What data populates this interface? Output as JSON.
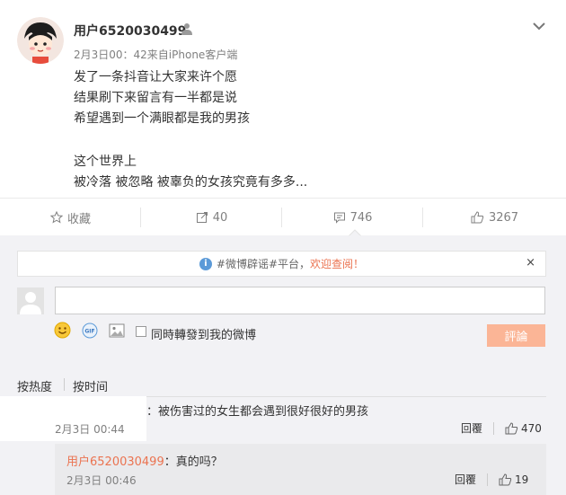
{
  "post": {
    "username": "用户6520030499",
    "meta": "2月3日00：42来自iPhone客户端",
    "lines": [
      "发了一条抖音让大家来许个愿",
      "结果刷下来留言有一半都是说",
      "希望遇到一个满眼都是我的男孩",
      "这个世界上",
      "被冷落 被忽略 被辜负的女孩究竟有多多..."
    ]
  },
  "actions": {
    "favorite": "收藏",
    "repost": "40",
    "comment": "746",
    "like": "3267"
  },
  "notice": {
    "prefix": "#微博辟谣#平台，",
    "highlight": "欢迎查阅！",
    "close": "×"
  },
  "composer": {
    "repost_label": "同時轉發到我的微博",
    "submit": "評論"
  },
  "sort": {
    "hot": "按热度",
    "time": "按时间"
  },
  "comments": [
    {
      "text": "：被伤害过的女生都会遇到很好很好的男孩",
      "time": "2月3日 00:44",
      "reply": "回覆",
      "likes": "470"
    }
  ],
  "replies": [
    {
      "name": "用户6520030499",
      "text": "：真的吗？",
      "time": "2月3日 00:46",
      "reply": "回覆",
      "likes": "19"
    }
  ],
  "colors": {
    "accent": "#eb7350",
    "submit_bg": "#fbb596",
    "comment_bg": "#f2f2f5",
    "muted": "#808080"
  },
  "icons": [
    "avatar-cartoon",
    "user-badge-icon",
    "chevron-down-icon",
    "star-icon",
    "repost-icon",
    "comment-icon",
    "thumb-up-icon",
    "info-icon",
    "close-icon",
    "emoji-icon",
    "gif-icon",
    "image-icon"
  ]
}
